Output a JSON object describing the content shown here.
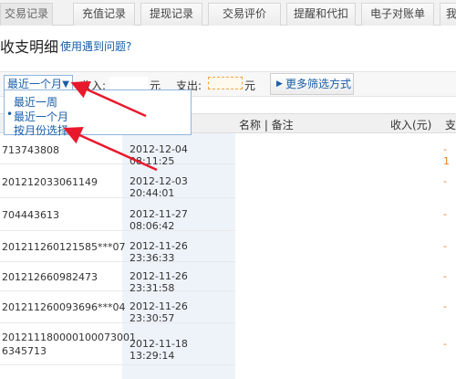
{
  "tabs": [
    {
      "label": "交易记录",
      "active": true
    },
    {
      "label": "充值记录"
    },
    {
      "label": "提现记录"
    },
    {
      "label": "交易评价"
    },
    {
      "label": "提醒和代扣"
    },
    {
      "label": "电子对账单"
    },
    {
      "label": "我"
    }
  ],
  "page_title": "收支明细",
  "help_link": "使用遇到问题?",
  "filter": {
    "period_selected": "最近一个月",
    "income_label": "收入:",
    "unit": "元",
    "expense_label": "支出:",
    "more_filters": "更多筛选方式"
  },
  "dropdown_options": [
    {
      "label": "最近一周",
      "selected": false
    },
    {
      "label": "最近一个月",
      "selected": true
    },
    {
      "label": "按月份选择",
      "selected": false
    }
  ],
  "table": {
    "headers": {
      "name": "名称 | 备注",
      "income": "收入(元)",
      "expense": "支"
    },
    "rows": [
      {
        "id": "713743808",
        "time": "2012-12-04 08:11:25",
        "amount": "- 1"
      },
      {
        "id": "201212033061149",
        "time": "2012-12-03 20:44:01",
        "amount": "-"
      },
      {
        "id": "704443613",
        "time": "2012-11-27 08:06:42",
        "amount": "-"
      },
      {
        "id": "201211260121585***07",
        "time": "2012-11-26 23:36:33",
        "amount": "-"
      },
      {
        "id": "201212660982473",
        "time": "2012-11-26 23:31:58",
        "amount": "-"
      },
      {
        "id": "201211260093696***04",
        "time": "2012-11-26 23:30:57",
        "amount": "-"
      },
      {
        "id": "201211180000100073001 6345713",
        "time": "2012-11-18 13:29:14",
        "amount": "-"
      }
    ]
  },
  "colors": {
    "link": "#1a5ea8",
    "annotation": "#e8192c",
    "expense": "#e67e22"
  }
}
